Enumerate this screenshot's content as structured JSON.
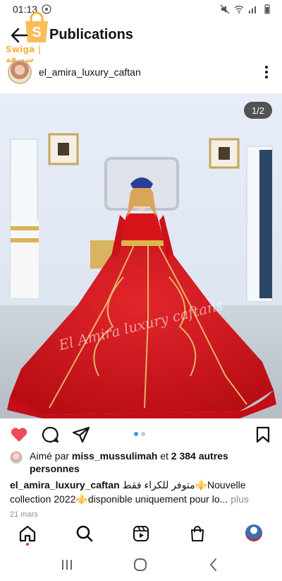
{
  "status_bar": {
    "time": "01:13"
  },
  "watermark": {
    "brand_text": "Swiga | سويقة",
    "color": "#f6b33b"
  },
  "app_bar": {
    "title": "Publications"
  },
  "post": {
    "username": "el_amira_luxury_caftan",
    "image_counter": "1/2",
    "image_watermark": "El Amira luxury caftans",
    "likes": {
      "prefix": "Aimé par ",
      "liker": "miss_mussulimah",
      "middle": " et ",
      "count": "2 384 autres personnes"
    },
    "caption": {
      "username": "el_amira_luxury_caftan",
      "text": " متوفر للكراء فقط⚜️Nouvelle collection 2022⚜️disponible uniquement pour lo...",
      "more": " plus"
    },
    "date": "21 mars",
    "carousel_dots": {
      "total": 2,
      "active": 1
    }
  },
  "colors": {
    "like_red": "#ed4956",
    "dress_red": "#d8141b",
    "carousel_active": "#3897f0",
    "carousel_inactive": "#c7c7c7"
  },
  "icons": {
    "back": "arrow-left-icon",
    "more": "vertical-dots-icon",
    "like": "heart-filled-icon",
    "comment": "comment-bubble-icon",
    "share": "paper-plane-icon",
    "save": "bookmark-icon",
    "home": "home-icon",
    "search": "search-icon",
    "reels": "reels-icon",
    "shop": "shopping-bag-icon"
  }
}
